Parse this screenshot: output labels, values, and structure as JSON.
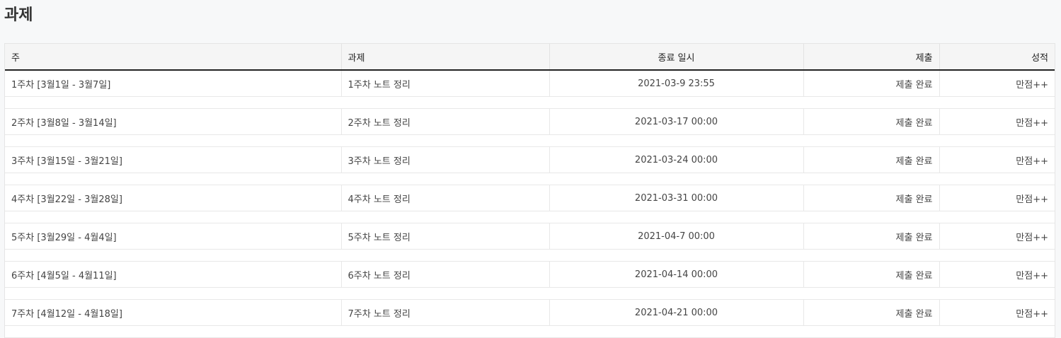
{
  "page": {
    "title": "과제"
  },
  "table": {
    "headers": {
      "week": "주",
      "assignment": "과제",
      "due": "종료 일시",
      "submission": "제출",
      "grade": "성적"
    },
    "rows": [
      {
        "week": "1주차 [3월1일 - 3월7일]",
        "assignment": "1주차 노트 정리",
        "due": "2021-03-9 23:55",
        "submission": "제출 완료",
        "grade": "만점++"
      },
      {
        "week": "2주차 [3월8일 - 3월14일]",
        "assignment": "2주차 노트 정리",
        "due": "2021-03-17 00:00",
        "submission": "제출 완료",
        "grade": "만점++"
      },
      {
        "week": "3주차 [3월15일 - 3월21일]",
        "assignment": "3주차 노트 정리",
        "due": "2021-03-24 00:00",
        "submission": "제출 완료",
        "grade": "만점++"
      },
      {
        "week": "4주차 [3월22일 - 3월28일]",
        "assignment": "4주차 노트 정리",
        "due": "2021-03-31 00:00",
        "submission": "제출 완료",
        "grade": "만점++"
      },
      {
        "week": "5주차 [3월29일 - 4월4일]",
        "assignment": "5주차 노트 정리",
        "due": "2021-04-7 00:00",
        "submission": "제출 완료",
        "grade": "만점++"
      },
      {
        "week": "6주차 [4월5일 - 4월11일]",
        "assignment": "6주차 노트 정리",
        "due": "2021-04-14 00:00",
        "submission": "제출 완료",
        "grade": "만점++"
      },
      {
        "week": "7주차 [4월12일 - 4월18일]",
        "assignment": "7주차 노트 정리",
        "due": "2021-04-21 00:00",
        "submission": "제출 완료",
        "grade": "만점++"
      }
    ]
  }
}
